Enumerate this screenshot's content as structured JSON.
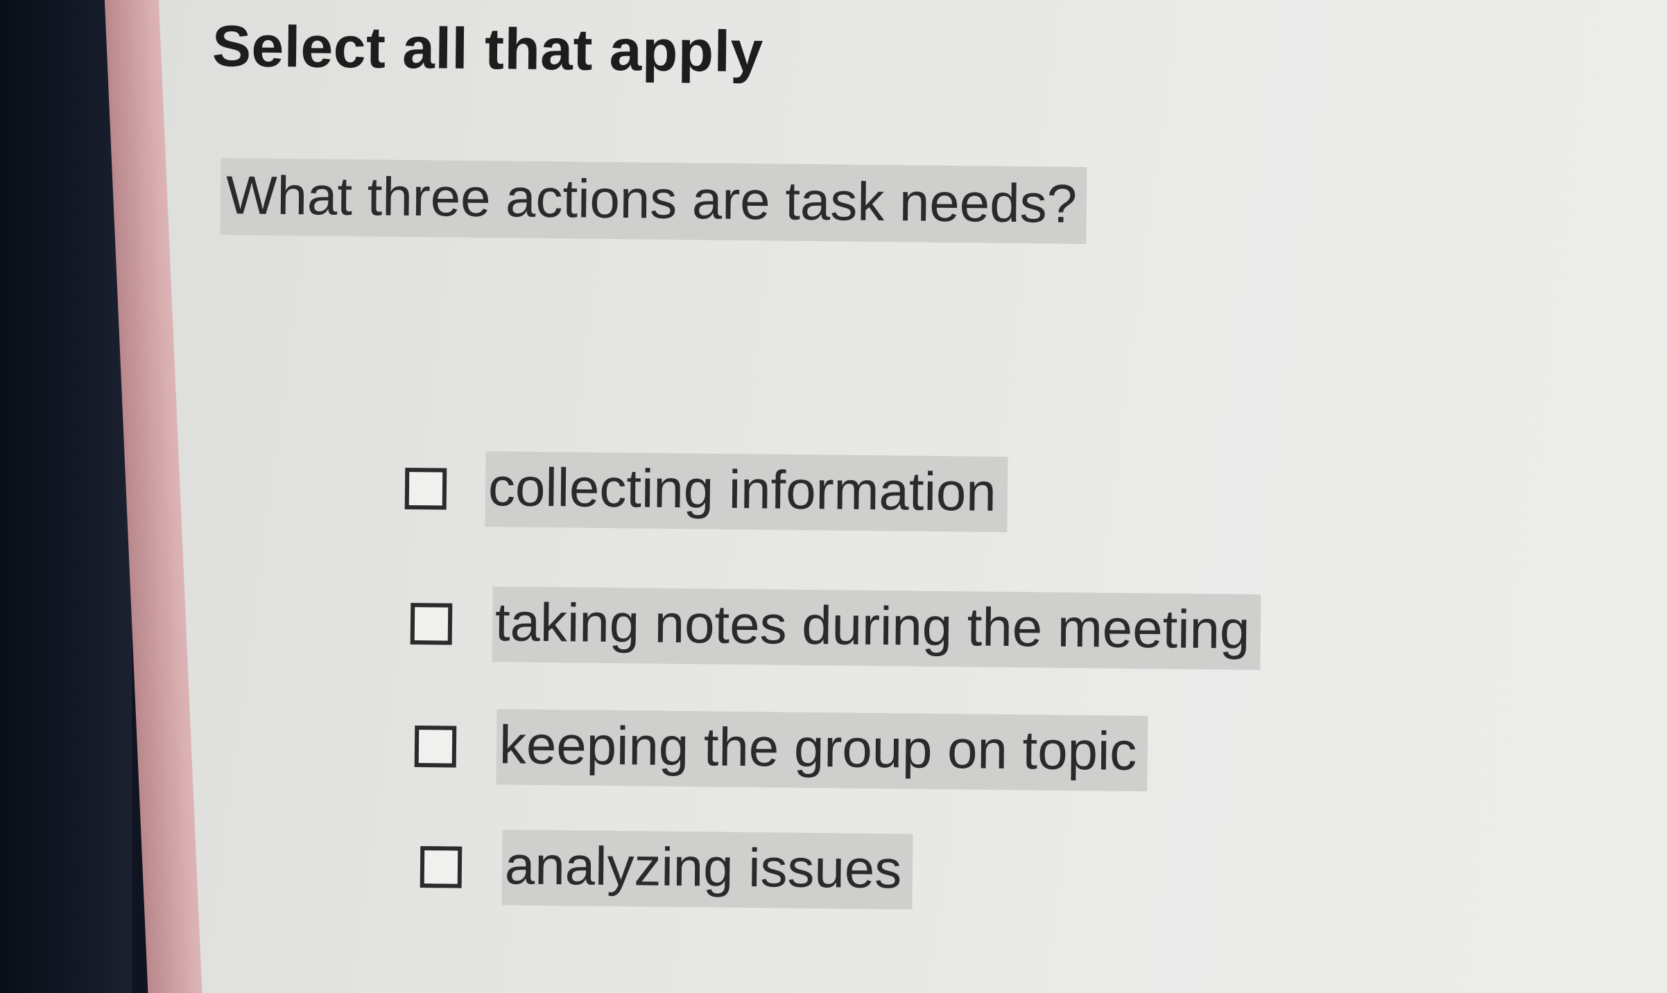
{
  "header": {
    "title": "Select all that apply"
  },
  "question": {
    "text": "What three actions are task needs?"
  },
  "options": [
    {
      "label": "collecting information",
      "checked": false
    },
    {
      "label": "taking notes during the meeting",
      "checked": false
    },
    {
      "label": "keeping the group on topic",
      "checked": false
    },
    {
      "label": "analyzing issues",
      "checked": false
    }
  ],
  "colors": {
    "screen_background": "#e8e8e6",
    "text_highlight": "#cfd0cd",
    "text": "#222222",
    "bezel": "#dcb4b4"
  }
}
